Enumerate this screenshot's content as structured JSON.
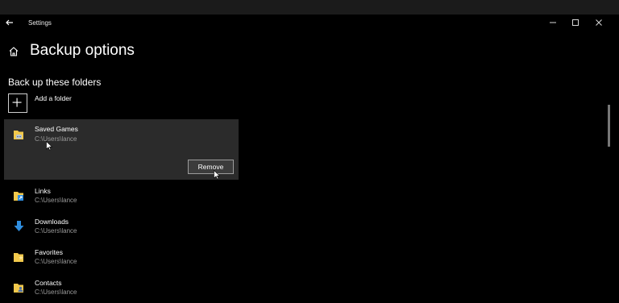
{
  "window": {
    "title": "Settings"
  },
  "header": {
    "title": "Backup options"
  },
  "section": {
    "title": "Back up these folders"
  },
  "add_folder": {
    "label": "Add a folder"
  },
  "folders": [
    {
      "name": "Saved Games",
      "path": "C:\\Users\\lance",
      "icon": "saved-games-folder-icon",
      "selected": true
    },
    {
      "name": "Links",
      "path": "C:\\Users\\lance",
      "icon": "links-folder-icon"
    },
    {
      "name": "Downloads",
      "path": "C:\\Users\\lance",
      "icon": "download-arrow-icon"
    },
    {
      "name": "Favorites",
      "path": "C:\\Users\\lance",
      "icon": "favorites-folder-icon"
    },
    {
      "name": "Contacts",
      "path": "C:\\Users\\lance",
      "icon": "contacts-folder-icon"
    }
  ],
  "selected_actions": {
    "remove_label": "Remove"
  },
  "colors": {
    "background": "#000000",
    "selected_item": "#2b2b2b",
    "folder_yellow": "#f2c94c",
    "download_blue": "#2f8ee0"
  }
}
